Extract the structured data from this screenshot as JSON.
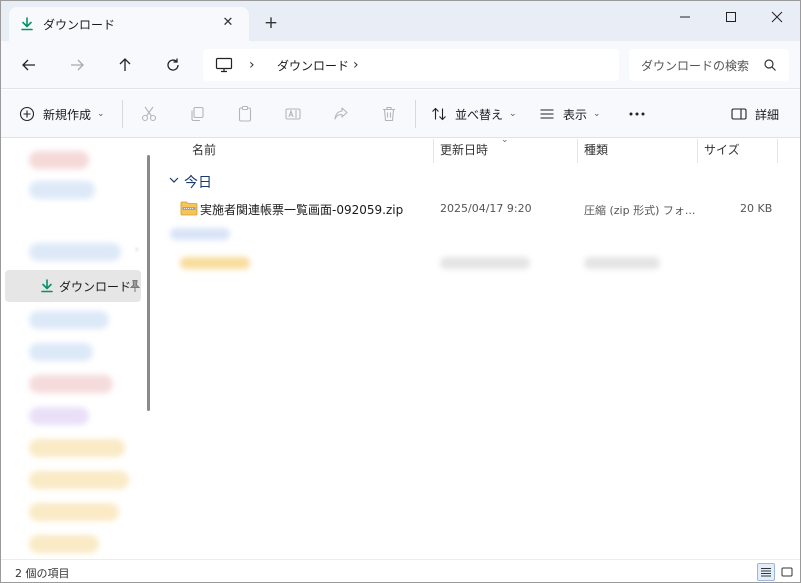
{
  "tab": {
    "title": "ダウンロード"
  },
  "address": {
    "location": "ダウンロード",
    "search_placeholder": "ダウンロードの検索"
  },
  "commands": {
    "new": "新規作成",
    "sort": "並べ替え",
    "view": "表示",
    "details": "詳細"
  },
  "navigation": {
    "selected": "ダウンロード"
  },
  "columns": {
    "name": "名前",
    "modified": "更新日時",
    "type": "種類",
    "size": "サイズ"
  },
  "groups": [
    {
      "label": "今日",
      "files": [
        {
          "name": "実施者関連帳票一覧画面-092059.zip",
          "modified": "2025/04/17 9:20",
          "type": "圧縮 (zip 形式) フォ...",
          "size": "20 KB"
        }
      ]
    }
  ],
  "status": {
    "item_count": "2 個の項目"
  },
  "colors": {
    "accent": "#0a8f6a",
    "selection": "#e6e6e6",
    "folder": "#f5c55a"
  }
}
